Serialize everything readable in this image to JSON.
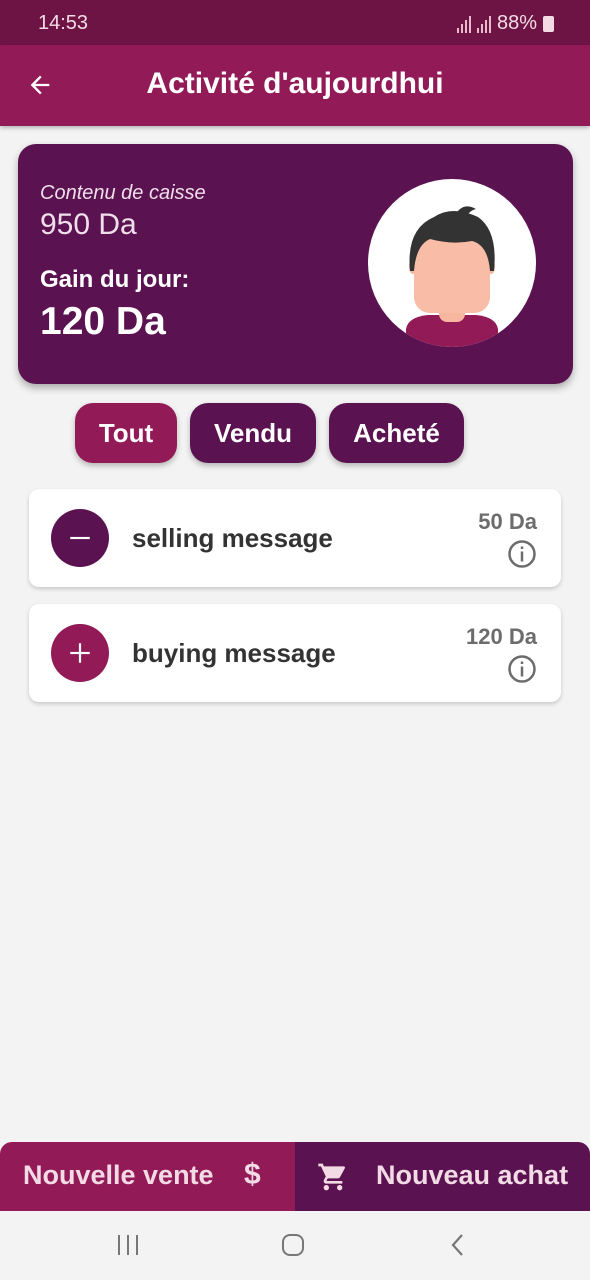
{
  "status_bar": {
    "time": "14:53",
    "battery_text": "88%",
    "icons": [
      "signal-icon",
      "signal-icon",
      "battery-charging-icon"
    ]
  },
  "app_bar": {
    "title": "Activité d'aujourdhui",
    "back_icon": "arrow-left-icon"
  },
  "summary": {
    "cash_label": "Contenu de caisse",
    "cash_value": "950 Da",
    "gain_label": "Gain du jour:",
    "gain_value": "120 Da",
    "avatar_icon": "user-avatar-icon"
  },
  "filters": [
    {
      "label": "Tout",
      "selected": true
    },
    {
      "label": "Vendu",
      "selected": false
    },
    {
      "label": "Acheté",
      "selected": false
    }
  ],
  "activities": [
    {
      "icon": "minus-icon",
      "text": "selling message",
      "amount": "50 Da",
      "icon_color": "#5a1350"
    },
    {
      "icon": "plus-icon",
      "text": "buying message",
      "amount": "120 Da",
      "icon_color": "#921a56"
    }
  ],
  "bottom_actions": {
    "new_sale": "Nouvelle vente",
    "new_sale_icon": "$",
    "new_purchase": "Nouveau achat",
    "new_purchase_icon": "cart-icon"
  },
  "colors": {
    "primary": "#921a56",
    "dark": "#5a1350",
    "status_bar": "#6e1444",
    "background": "#f3f3f3"
  }
}
